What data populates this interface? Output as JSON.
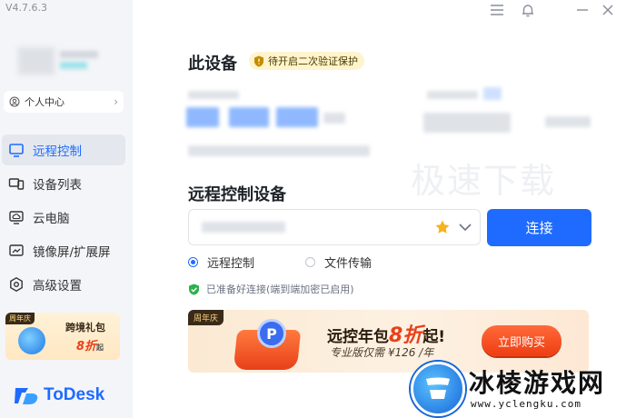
{
  "app": {
    "version": "V4.7.6.3",
    "brand_name": "ToDesk",
    "accent": "#1f6bff"
  },
  "sidebar": {
    "personal_center": "个人中心",
    "items": [
      {
        "label": "远程控制",
        "icon": "remote-control-icon",
        "active": true
      },
      {
        "label": "设备列表",
        "icon": "device-list-icon",
        "active": false
      },
      {
        "label": "云电脑",
        "icon": "cloud-pc-icon",
        "active": false
      },
      {
        "label": "镜像屏/扩展屏",
        "icon": "mirror-screen-icon",
        "active": false
      },
      {
        "label": "高级设置",
        "icon": "settings-icon",
        "active": false
      }
    ],
    "promo": {
      "tag": "周年庆",
      "title": "跨境礼包",
      "discount": "8折",
      "suffix": "起"
    }
  },
  "main": {
    "this_device_title": "此设备",
    "twofa_badge": "待开启二次验证保护",
    "remote_title": "远程控制设备",
    "connect_label": "连接",
    "modes": [
      {
        "label": "远程控制",
        "selected": true
      },
      {
        "label": "文件传输",
        "selected": false
      }
    ],
    "ready_status": "已准备好连接(端到端加密已启用)",
    "watermark_text": "极速下载"
  },
  "banner": {
    "tag": "周年庆",
    "headline_pre": "远控年包",
    "headline_big": "8折",
    "headline_post": "起!",
    "subline": "专业版仅需 ¥126 /年",
    "buy_label": "立即购买"
  },
  "overlay": {
    "site_name": "冰棱游戏网",
    "site_url": "www.yclengku.com"
  }
}
